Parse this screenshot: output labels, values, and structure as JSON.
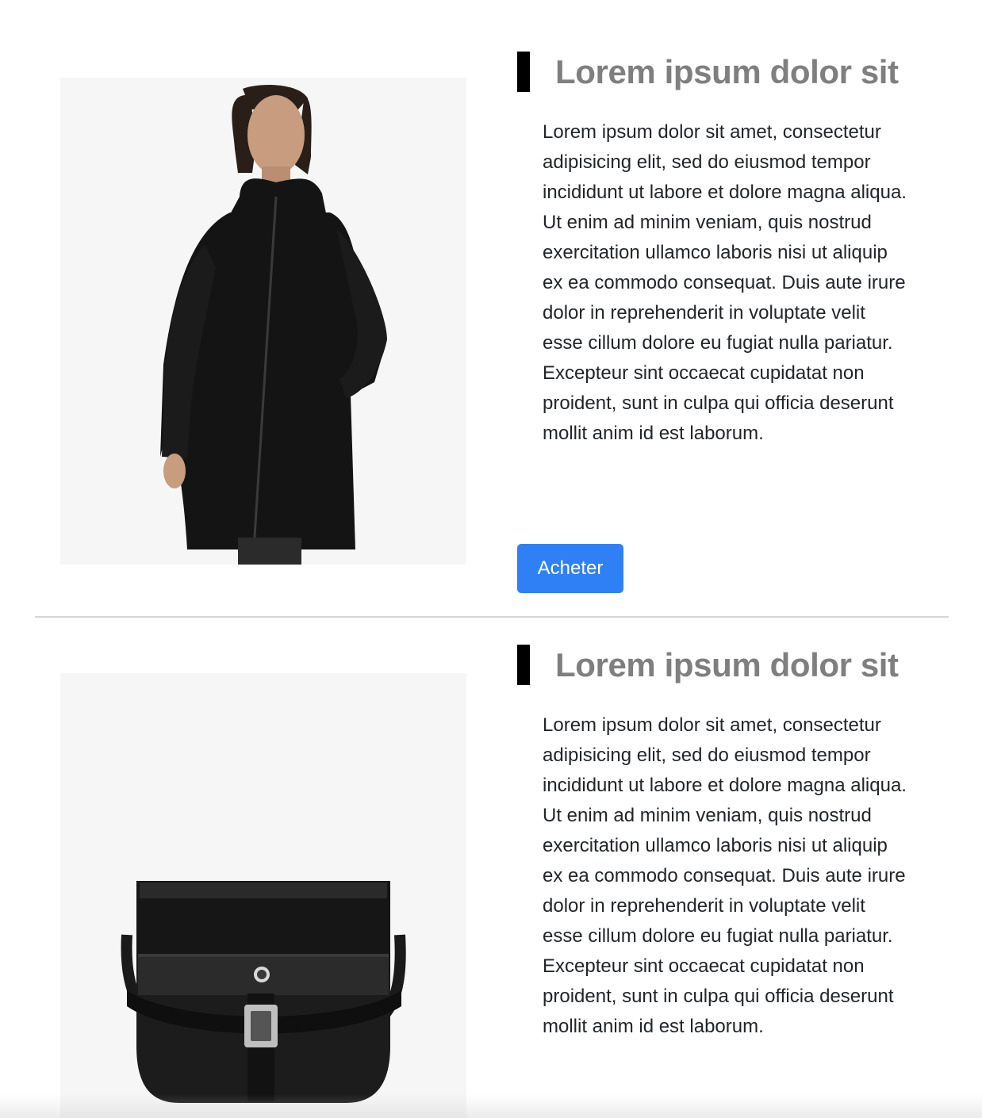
{
  "products": [
    {
      "title": "Lorem ipsum dolor sit",
      "description": "Lorem ipsum dolor sit amet, consectetur adipisicing elit, sed do eiusmod tempor incididunt ut labore et dolore magna aliqua. Ut enim ad minim veniam, quis nostrud exercitation ullamco laboris nisi ut aliquip ex ea commodo consequat. Duis aute irure dolor in reprehenderit in voluptate velit esse cillum dolore eu fugiat nulla pariatur. Excepteur sint occaecat cupidatat non proident, sunt in culpa qui officia deserunt mollit anim id est laborum.",
      "button_label": "Acheter",
      "image": "woman-black-raincoat-photo"
    },
    {
      "title": "Lorem ipsum dolor sit",
      "description": "Lorem ipsum dolor sit amet, consectetur adipisicing elit, sed do eiusmod tempor incididunt ut labore et dolore magna aliqua. Ut enim ad minim veniam, quis nostrud exercitation ullamco laboris nisi ut aliquip ex ea commodo consequat. Duis aute irure dolor in reprehenderit in voluptate velit esse cillum dolore eu fugiat nulla pariatur. Excepteur sint occaecat cupidatat non proident, sunt in culpa qui officia deserunt mollit anim id est laborum.",
      "image": "black-crossbody-bag-photo"
    }
  ],
  "colors": {
    "title": "#7f7f7f",
    "accent_bar": "#000000",
    "button": "#2f80f5",
    "divider": "#d6d6d6",
    "image_background": "#f6f6f6"
  }
}
